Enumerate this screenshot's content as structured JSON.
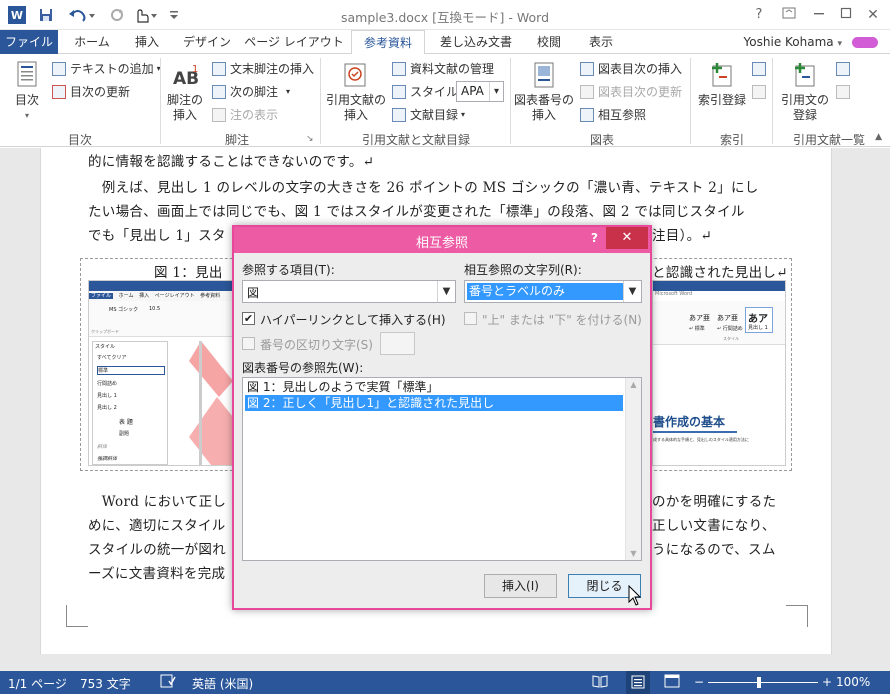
{
  "window": {
    "title": "sample3.docx [互換モード] - Word",
    "help": "?",
    "restore": "□",
    "minimize": "—",
    "maximize": "□",
    "close": "✕"
  },
  "qat": {
    "save": "💾",
    "undo": "↶",
    "redo": "↻",
    "touch": "✋",
    "more": "≡"
  },
  "tabs": {
    "file": "ファイル",
    "home": "ホーム",
    "insert": "挿入",
    "design": "デザイン",
    "layout": "ページ レイアウト",
    "references": "参考資料",
    "mailings": "差し込み文書",
    "review": "校閲",
    "view": "表示"
  },
  "user": "Yoshie Kohama",
  "ribbon": {
    "toc": {
      "button": "目次",
      "add_text": "テキストの追加",
      "update": "目次の更新",
      "group": "目次"
    },
    "footnotes": {
      "insert": "脚注の挿入",
      "endnote": "文末脚注の挿入",
      "next": "次の脚注",
      "show": "注の表示",
      "group": "脚注"
    },
    "citations": {
      "insert": "引用文献の挿入",
      "manage": "資料文献の管理",
      "style_label": "スタイル:",
      "style_value": "APA",
      "bibliography": "文献目録",
      "group": "引用文献と文献目録"
    },
    "captions": {
      "insert": "図表番号の挿入",
      "insert_tof": "図表目次の挿入",
      "update_tof": "図表目次の更新",
      "crossref": "相互参照",
      "group": "図表"
    },
    "index": {
      "mark": "索引登録",
      "group": "索引"
    },
    "toa": {
      "mark": "引用文の登録",
      "group": "引用文献一覧"
    }
  },
  "document": {
    "line1": "的に情報を認識することはできないのです。↵",
    "line2": "　例えば、見出し 1 のレベルの文字の大きさを 26 ポイントの MS ゴシックの「濃い青、テキスト 2」にし",
    "line3": "たい場合、画面上では同じでも、図 1 ではスタイルが変更された「標準」の段落、図 2 では同じスタイル",
    "line4": "でも「見出し 1」スタ",
    "line4_tail": "注目）。↵",
    "fig_caption_left": "図 1：見出",
    "fig_caption_right": "と認識された見出し↵",
    "line5": "　Word において正し",
    "line5_tail": "のかを明確にするた",
    "line6": "めに、適切にスタイル",
    "line6_tail": "正しい文書になり、",
    "line7": "スタイルの統一が図れ",
    "line7_tail": "うになるので、スム",
    "line8": "ーズに文書資料を完成",
    "fig_right_heading": "書作成の基本",
    "fig_right_text": "成する具体的な手順と、見出しのスタイル適用方法に",
    "fig_right_title": "Microsoft Word",
    "fig_right_style1": "あア亜",
    "fig_right_style2": "あア亜",
    "fig_right_style3": "あア",
    "fig_right_style_label1": "↵ 標準",
    "fig_right_style_label2": "↵ 行間詰め",
    "fig_right_style_label3": "見出し 1",
    "fig_right_group": "スタイル"
  },
  "thumb": {
    "tabs": [
      "ファイル",
      "ホーム",
      "挿入",
      "ページレイアウト",
      "参考資料"
    ],
    "font": "MS ゴシック",
    "size": "10.5",
    "pane_title": "スタイル",
    "styles": [
      "すべてクリア",
      "標準",
      "行間詰め",
      "見出し 1",
      "見出し 2",
      "表 題",
      "副題",
      "斜体",
      "強調斜体"
    ],
    "clipboard": "クリップボード"
  },
  "dialog": {
    "title": "相互参照",
    "help": "?",
    "close": "✕",
    "ref_type_label": "参照する項目(T):",
    "ref_type_value": "図",
    "insert_ref_label": "相互参照の文字列(R):",
    "insert_ref_value": "番号とラベルのみ",
    "hyperlink_label": "ハイパーリンクとして挿入する(H)",
    "hyperlink_checked": true,
    "above_below_label": "\"上\" または \"下\" を付ける(N)",
    "separator_label": "番号の区切り文字(S)",
    "for_which_label": "図表番号の参照先(W):",
    "items": [
      "図 1：見出しのようで実質「標準」",
      "図 2：正しく「見出し1」と認識された見出し"
    ],
    "selected_index": 1,
    "insert_button": "挿入(I)",
    "close_button": "閉じる"
  },
  "status": {
    "page": "1/1 ページ",
    "words": "753 文字",
    "lang": "英語 (米国)",
    "zoom": "100%",
    "zoom_minus": "−",
    "zoom_plus": "+"
  }
}
